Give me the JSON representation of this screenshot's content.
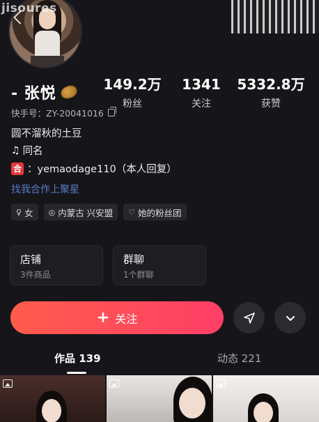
{
  "watermark": "jisoures",
  "profile": {
    "name": "- 张悦",
    "account_id": "快手号：ZY-20041016"
  },
  "stats": [
    {
      "value": "149.2万",
      "label": "粉丝"
    },
    {
      "value": "1341",
      "label": "关注"
    },
    {
      "value": "5332.8万",
      "label": "获赞"
    }
  ],
  "bio": {
    "line1": "圆不溜秋的土豆",
    "line2": "同名",
    "line3_badge": "合",
    "line3": "：yemaodage110（本人回复）",
    "link": "找我合作上聚星"
  },
  "tags": [
    {
      "icon": "female-icon",
      "glyph": "♀",
      "label": "女"
    },
    {
      "icon": "location-icon",
      "glyph": "◎",
      "label": "内蒙古 兴安盟"
    },
    {
      "icon": "heart-icon",
      "glyph": "♡",
      "label": "她的粉丝团"
    }
  ],
  "cards": [
    {
      "title": "店铺",
      "subtitle": "3件商品"
    },
    {
      "title": "群聊",
      "subtitle": "1个群聊"
    }
  ],
  "actions": {
    "follow_label": "关注",
    "follow_plus": "+"
  },
  "tabs": [
    {
      "label": "作品 139"
    },
    {
      "label": "动态 221"
    }
  ],
  "colors": {
    "background": "#16161a",
    "follow_gradient_start": "#ff5c4c",
    "follow_gradient_end": "#ff3f67",
    "link": "#5a78c9",
    "badge_red": "#e8383d"
  }
}
